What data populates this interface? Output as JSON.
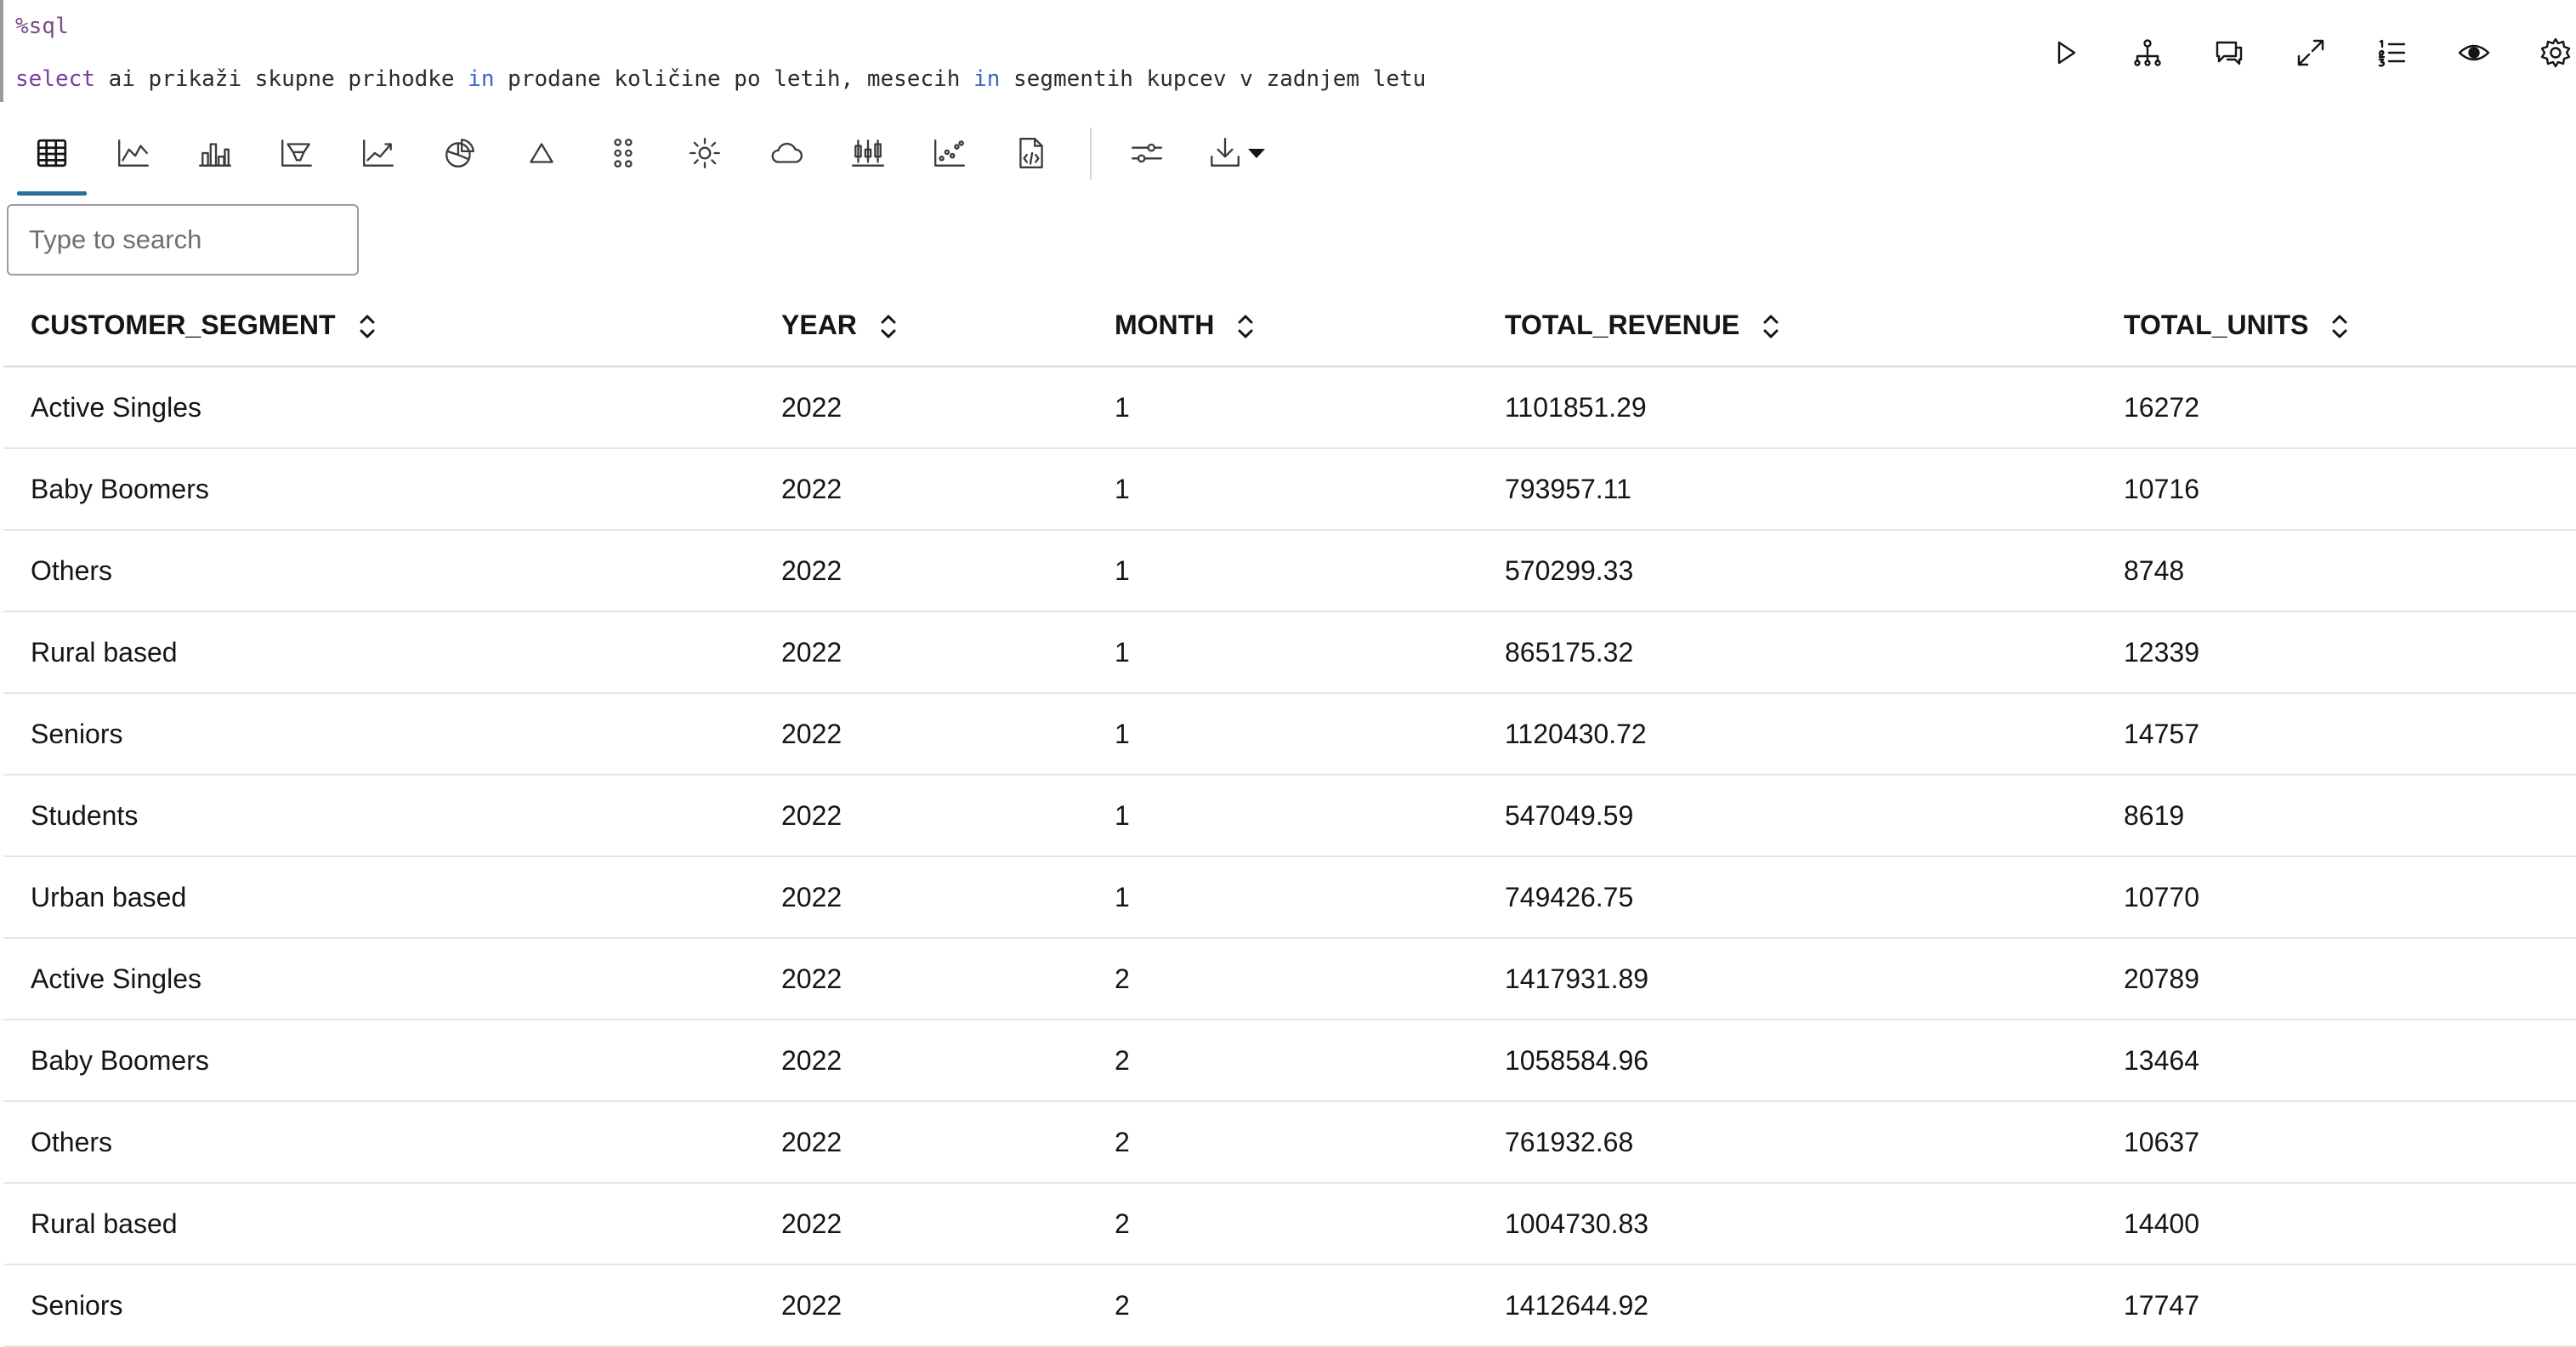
{
  "editor": {
    "magic": "%sql",
    "query_tokens": [
      {
        "t": "select",
        "c": "kw"
      },
      {
        "t": " ai prikaži skupne prihodke ",
        "c": ""
      },
      {
        "t": "in",
        "c": "kw2"
      },
      {
        "t": " prodane količine po letih, mesecih ",
        "c": ""
      },
      {
        "t": "in",
        "c": "kw2"
      },
      {
        "t": " segmentih kupcev v zadnjem letu",
        "c": ""
      }
    ]
  },
  "cell_actions": [
    "run-icon",
    "hierarchy-icon",
    "comments-icon",
    "expand-icon",
    "numbered-list-icon",
    "eye-icon",
    "gear-icon"
  ],
  "toolbar": {
    "active": "table-view",
    "views": [
      "table-view",
      "line-chart",
      "bar-chart",
      "funnel-chart",
      "trend-line-chart",
      "pie-chart",
      "pyramid-chart",
      "dot-grid-chart",
      "sunburst-chart",
      "cloud-chart",
      "boxplot-chart",
      "scatter-chart",
      "code-report"
    ],
    "extra": [
      "settings-sliders",
      "download"
    ]
  },
  "search": {
    "placeholder": "Type to search",
    "value": ""
  },
  "table": {
    "columns": [
      "CUSTOMER_SEGMENT",
      "YEAR",
      "MONTH",
      "TOTAL_REVENUE",
      "TOTAL_UNITS"
    ],
    "rows": [
      [
        "Active Singles",
        "2022",
        "1",
        "1101851.29",
        "16272"
      ],
      [
        "Baby Boomers",
        "2022",
        "1",
        "793957.11",
        "10716"
      ],
      [
        "Others",
        "2022",
        "1",
        "570299.33",
        "8748"
      ],
      [
        "Rural based",
        "2022",
        "1",
        "865175.32",
        "12339"
      ],
      [
        "Seniors",
        "2022",
        "1",
        "1120430.72",
        "14757"
      ],
      [
        "Students",
        "2022",
        "1",
        "547049.59",
        "8619"
      ],
      [
        "Urban based",
        "2022",
        "1",
        "749426.75",
        "10770"
      ],
      [
        "Active Singles",
        "2022",
        "2",
        "1417931.89",
        "20789"
      ],
      [
        "Baby Boomers",
        "2022",
        "2",
        "1058584.96",
        "13464"
      ],
      [
        "Others",
        "2022",
        "2",
        "761932.68",
        "10637"
      ],
      [
        "Rural based",
        "2022",
        "2",
        "1004730.83",
        "14400"
      ],
      [
        "Seniors",
        "2022",
        "2",
        "1412644.92",
        "17747"
      ]
    ]
  }
}
